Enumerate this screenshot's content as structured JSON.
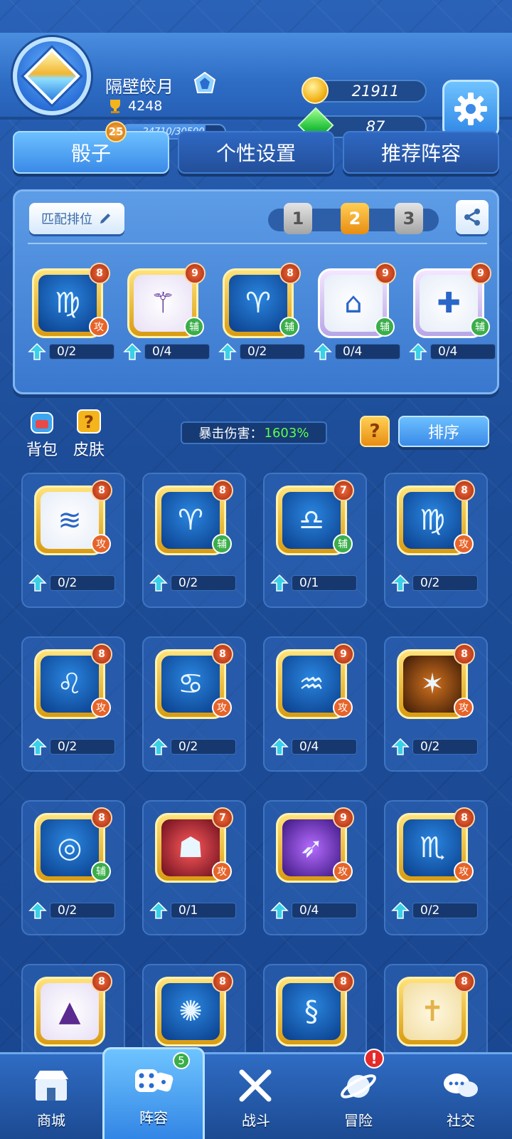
{
  "player": {
    "name": "隔壁皎月",
    "trophies": "4248",
    "level": "25",
    "xp": "24710/30500",
    "xp_fraction": 0.81
  },
  "currency": {
    "gold": "21911",
    "gems": "87"
  },
  "tabs": [
    "骰子",
    "个性设置",
    "推荐阵容"
  ],
  "active_tab": 0,
  "loadout": {
    "match_label": "匹配排位",
    "slots": [
      "1",
      "2",
      "3"
    ],
    "selected_slot": 1,
    "dice": [
      {
        "icon": "virgo-icon",
        "level": "8",
        "type": "攻",
        "progress": "0/2",
        "face": "blue",
        "frame": "gold"
      },
      {
        "icon": "altar-icon",
        "level": "9",
        "type": "辅",
        "progress": "0/4",
        "face": "lilac",
        "frame": "gold"
      },
      {
        "icon": "aries-icon",
        "level": "8",
        "type": "辅",
        "progress": "0/2",
        "face": "blue",
        "frame": "gold"
      },
      {
        "icon": "magic-hat-icon",
        "level": "9",
        "type": "辅",
        "progress": "0/4",
        "face": "white",
        "frame": "rare"
      },
      {
        "icon": "healing-cross-icon",
        "level": "9",
        "type": "辅",
        "progress": "0/4",
        "face": "white",
        "frame": "rare"
      }
    ]
  },
  "toolbar": {
    "bag": "背包",
    "skin": "皮肤",
    "crit_label": "暴击伤害：",
    "crit_value": "1603%",
    "help": "?",
    "sort": "排序"
  },
  "collection": [
    {
      "icon": "shark-icon",
      "level": "8",
      "type": "攻",
      "progress": "0/2",
      "face": "white"
    },
    {
      "icon": "aries-icon",
      "level": "8",
      "type": "辅",
      "progress": "0/2",
      "face": "blue"
    },
    {
      "icon": "libra-icon",
      "level": "7",
      "type": "辅",
      "progress": "0/1",
      "face": "blue"
    },
    {
      "icon": "virgo-icon",
      "level": "8",
      "type": "攻",
      "progress": "0/2",
      "face": "blue"
    },
    {
      "icon": "leo-icon",
      "level": "8",
      "type": "攻",
      "progress": "0/2",
      "face": "blue"
    },
    {
      "icon": "cancer-icon",
      "level": "8",
      "type": "攻",
      "progress": "0/2",
      "face": "blue"
    },
    {
      "icon": "aquarius-icon",
      "level": "9",
      "type": "攻",
      "progress": "0/4",
      "face": "blue"
    },
    {
      "icon": "tiger-icon",
      "level": "8",
      "type": "攻",
      "progress": "0/2",
      "face": "brown"
    },
    {
      "icon": "target-coin-icon",
      "level": "8",
      "type": "辅",
      "progress": "0/2",
      "face": "blue"
    },
    {
      "icon": "vampire-icon",
      "level": "7",
      "type": "攻",
      "progress": "0/1",
      "face": "red"
    },
    {
      "icon": "archer-icon",
      "level": "9",
      "type": "攻",
      "progress": "0/4",
      "face": "purple"
    },
    {
      "icon": "scorpio-icon",
      "level": "8",
      "type": "攻",
      "progress": "0/2",
      "face": "blue"
    },
    {
      "icon": "witch-hat-icon",
      "level": "8",
      "type": "",
      "progress": "",
      "face": "lilac"
    },
    {
      "icon": "frost-burst-icon",
      "level": "8",
      "type": "",
      "progress": "",
      "face": "blue"
    },
    {
      "icon": "dragon-icon",
      "level": "8",
      "type": "",
      "progress": "",
      "face": "blue"
    },
    {
      "icon": "holy-cross-icon",
      "level": "8",
      "type": "",
      "progress": "",
      "face": "cream"
    }
  ],
  "bottom_nav": [
    {
      "label": "商城",
      "icon": "shop-icon"
    },
    {
      "label": "阵容",
      "icon": "dice-icon",
      "badge": "5",
      "active": true
    },
    {
      "label": "战斗",
      "icon": "crossed-swords-icon"
    },
    {
      "label": "冒险",
      "icon": "planet-icon",
      "alert": "!"
    },
    {
      "label": "社交",
      "icon": "chat-bubbles-icon"
    }
  ],
  "colors": {
    "background": "#1f4f9a",
    "accent": "#3a8ae8",
    "gold": "#f4b41c",
    "crit_green": "#5cff4a",
    "attack": "#e6642a",
    "support": "#3aae4a"
  }
}
